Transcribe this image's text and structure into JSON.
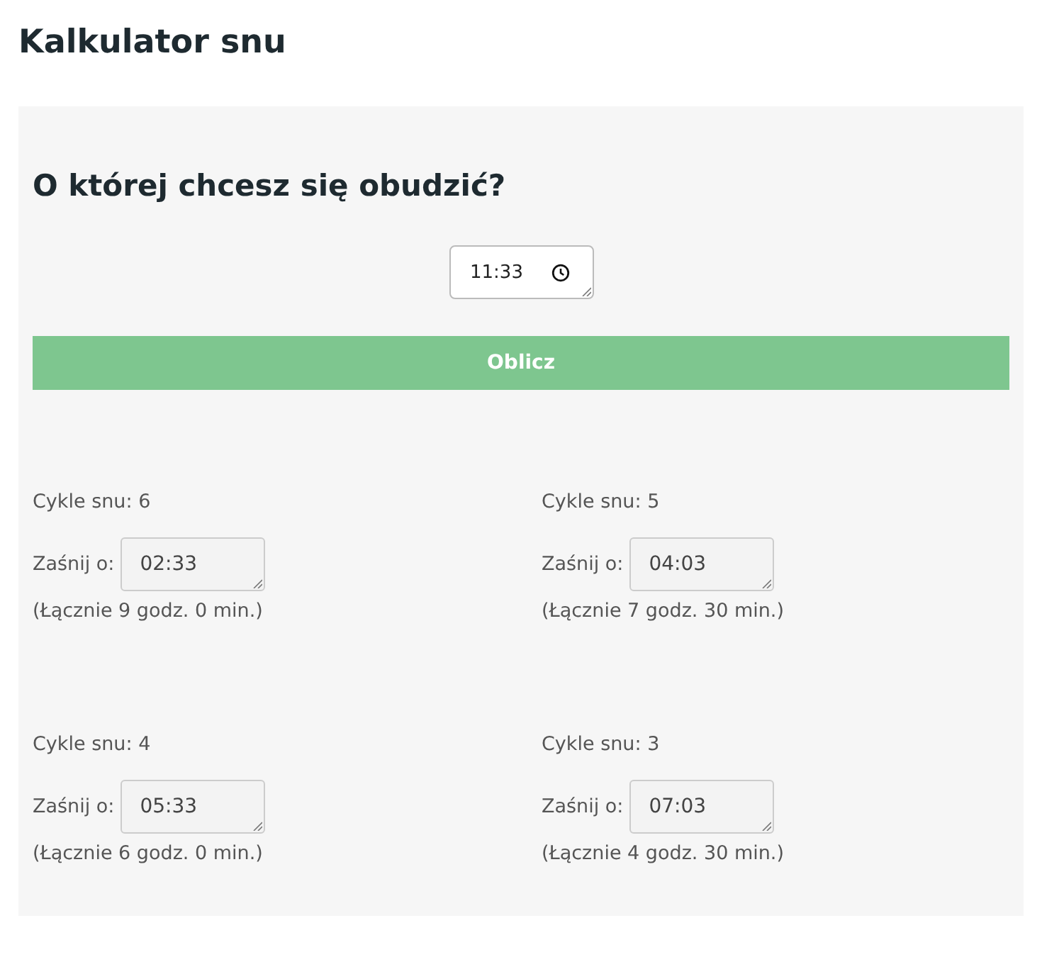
{
  "page": {
    "title": "Kalkulator snu"
  },
  "form": {
    "question": "O której chcesz się obudzić?",
    "wake_time": "11:33",
    "button": "Oblicz"
  },
  "results": [
    {
      "cycles_label": "Cykle snu: 6",
      "fall_asleep_label": "Zaśnij o:",
      "time": "02:33",
      "total": "(Łącznie 9 godz. 0 min.)"
    },
    {
      "cycles_label": "Cykle snu: 5",
      "fall_asleep_label": "Zaśnij o:",
      "time": "04:03",
      "total": "(Łącznie 7 godz. 30 min.)"
    },
    {
      "cycles_label": "Cykle snu: 4",
      "fall_asleep_label": "Zaśnij o:",
      "time": "05:33",
      "total": "(Łącznie 6 godz. 0 min.)"
    },
    {
      "cycles_label": "Cykle snu: 3",
      "fall_asleep_label": "Zaśnij o:",
      "time": "07:03",
      "total": "(Łącznie 4 godz. 30 min.)"
    }
  ]
}
